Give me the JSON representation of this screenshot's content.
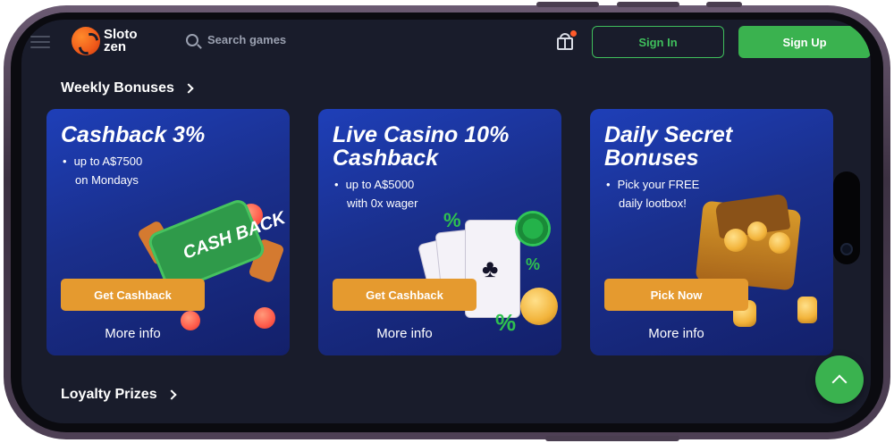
{
  "header": {
    "logo_line1": "Sloto",
    "logo_line2": "zen",
    "search_placeholder": "Search games",
    "signin_label": "Sign In",
    "signup_label": "Sign Up"
  },
  "sections": {
    "weekly_title": "Weekly Bonuses",
    "loyalty_title": "Loyalty Prizes"
  },
  "cards": [
    {
      "title": "Cashback 3%",
      "bullet_line1": "up to A$7500",
      "bullet_line2": "on Mondays",
      "button_label": "Get Cashback",
      "more_label": "More info",
      "art_text": "CASH BACK"
    },
    {
      "title": "Live Casino 10%\nCashback",
      "bullet_line1": "up to A$5000",
      "bullet_line2": "with 0x wager",
      "button_label": "Get Cashback",
      "more_label": "More info"
    },
    {
      "title": "Daily Secret\nBonuses",
      "bullet_line1": "Pick your FREE",
      "bullet_line2": "daily lootbox!",
      "button_label": "Pick Now",
      "more_label": "More info"
    }
  ],
  "colors": {
    "accent_green": "#3ab24f",
    "button_orange": "#e59a2f",
    "background": "#191c2b",
    "card_blue": "#1e3fb8"
  },
  "icons": [
    "hamburger-icon",
    "search-icon",
    "gift-icon",
    "chevron-right-icon",
    "chevron-up-icon"
  ]
}
